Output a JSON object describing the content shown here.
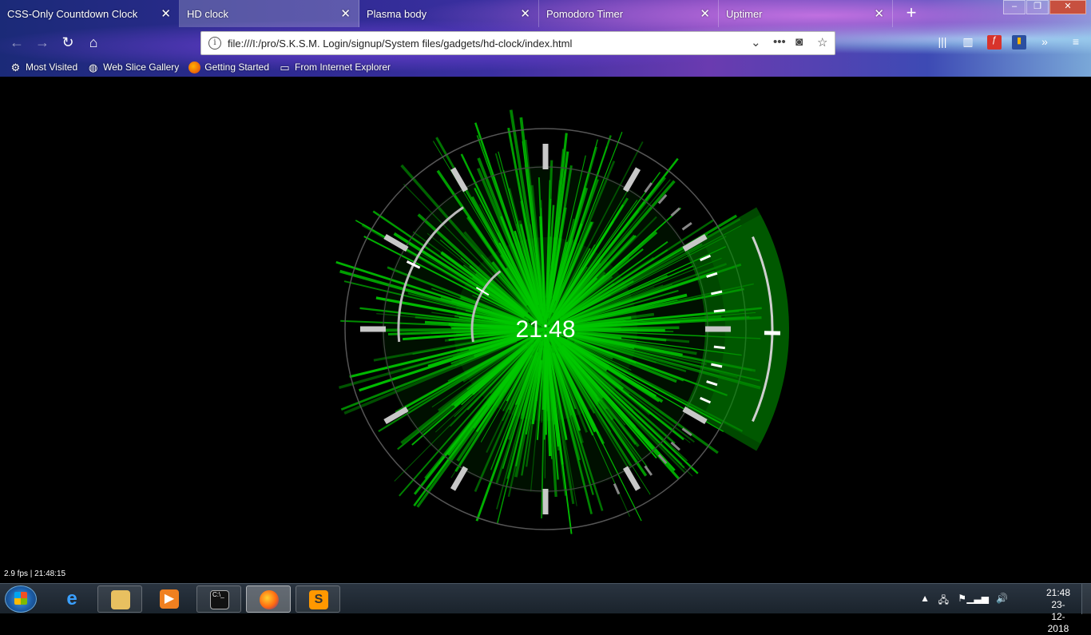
{
  "browser": {
    "tabs": [
      {
        "title": "CSS-Only Countdown Clock",
        "active": false
      },
      {
        "title": "HD clock",
        "active": true
      },
      {
        "title": "Plasma body",
        "active": false
      },
      {
        "title": "Pomodoro Timer",
        "active": false
      },
      {
        "title": "Uptimer",
        "active": false
      }
    ],
    "new_tab_icon": "plus-icon",
    "url": "file:///I:/pro/S.K.S.M. Login/signup/System files/gadgets/hd-clock/index.html",
    "bookmarks": [
      {
        "label": "Most Visited",
        "icon": "gear-icon"
      },
      {
        "label": "Web Slice Gallery",
        "icon": "globe-icon"
      },
      {
        "label": "Getting Started",
        "icon": "firefox-icon"
      },
      {
        "label": "From Internet Explorer",
        "icon": "folder-icon"
      }
    ]
  },
  "clock": {
    "time": "21:48",
    "fps_readout": "2.9 fps | 21:48:15",
    "accent": "#00c800"
  },
  "taskbar": {
    "pinned": [
      "internet-explorer-icon",
      "file-explorer-icon",
      "media-player-icon",
      "command-prompt-icon",
      "firefox-icon",
      "sublime-text-icon"
    ],
    "active": "firefox-icon",
    "time": "21:48",
    "date": "23-12-2018"
  }
}
